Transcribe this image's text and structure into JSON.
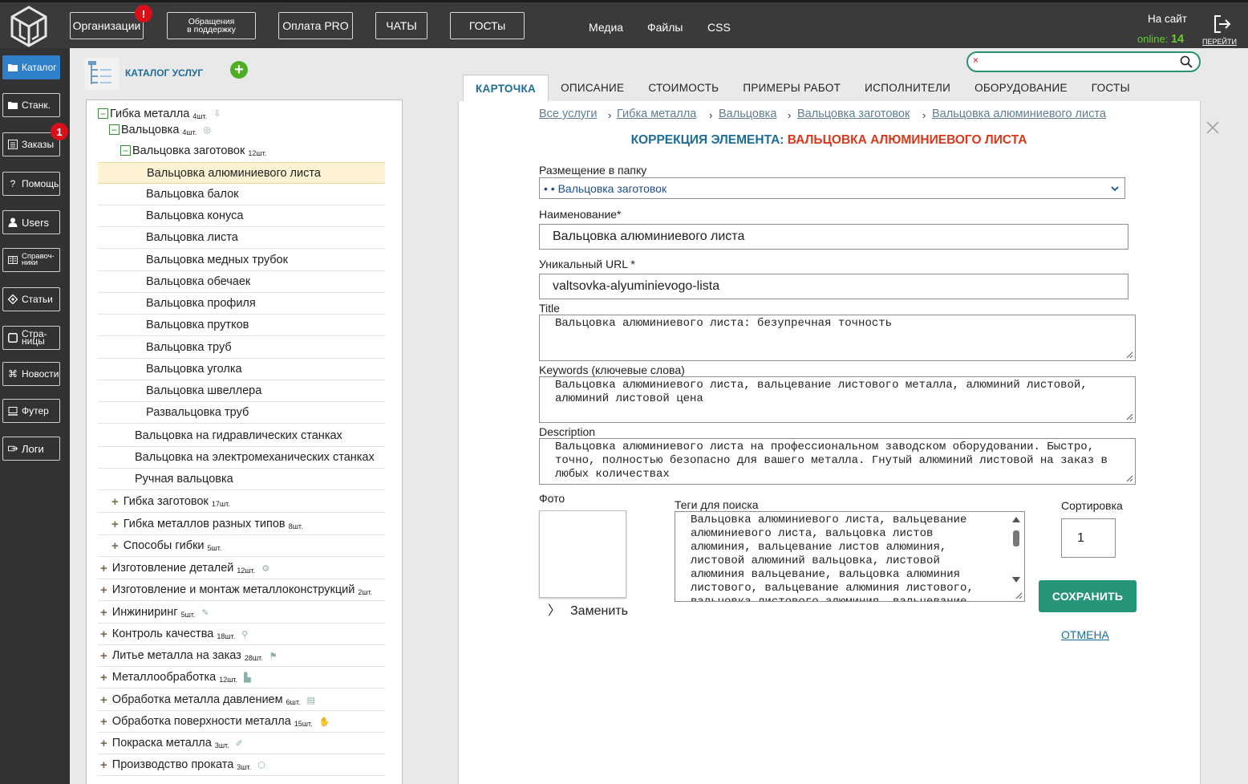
{
  "topbar": {
    "buttons": [
      {
        "label": "Организации"
      },
      {
        "label_line1": "Обращения",
        "label_line2": "в поддержку"
      },
      {
        "label": "Оплата PRO"
      },
      {
        "label": "ЧАТЫ"
      },
      {
        "label": "ГОСТы"
      }
    ],
    "org_badge": "!",
    "links": [
      "Медиа",
      "Файлы",
      "CSS"
    ],
    "onsite_label": "На сайт",
    "online_label": "online:",
    "online_count": "14",
    "exit_label": "ПЕРЕЙТИ"
  },
  "sidebar": {
    "items": [
      {
        "label": "Каталог",
        "icon": "folder-icon"
      },
      {
        "label": "Станк.",
        "icon": "folder-icon"
      },
      {
        "label": "Заказы",
        "icon": "list-icon",
        "badge": "1"
      },
      {
        "label": "Помощь",
        "icon": "question-icon"
      },
      {
        "label": "Users",
        "icon": "user-icon"
      },
      {
        "label_line1": "Справоч-",
        "label_line2": "ники",
        "icon": "book-icon"
      },
      {
        "label": "Статьи",
        "icon": "diamond-icon"
      },
      {
        "label_line1": "Стра-",
        "label_line2": "ницы",
        "icon": "page-icon"
      },
      {
        "label": "Новости",
        "icon": "command-icon"
      },
      {
        "label": "Футер",
        "icon": "monitor-icon"
      },
      {
        "label": "Логи",
        "icon": "log-icon"
      }
    ]
  },
  "catalog": {
    "title": "КАТАЛОГ УСЛУГ",
    "add_symbol": "+"
  },
  "tree": [
    {
      "label": "Гибка металла",
      "count": "4шт."
    },
    {
      "label": "Вальцовка",
      "count": "4шт."
    },
    {
      "label": "Вальцовка заготовок",
      "count": "12шт."
    },
    {
      "label": "Вальцовка алюминиевого листа"
    },
    {
      "label": "Вальцовка балок"
    },
    {
      "label": "Вальцовка конуса"
    },
    {
      "label": "Вальцовка листа"
    },
    {
      "label": "Вальцовка медных трубок"
    },
    {
      "label": "Вальцовка обечаек"
    },
    {
      "label": "Вальцовка профиля"
    },
    {
      "label": "Вальцовка прутков"
    },
    {
      "label": "Вальцовка труб"
    },
    {
      "label": "Вальцовка уголка"
    },
    {
      "label": "Вальцовка швеллера"
    },
    {
      "label": "Развальцовка труб"
    },
    {
      "label": "Вальцовка на гидравлических станках"
    },
    {
      "label": "Вальцовка на электромеханических станках"
    },
    {
      "label": "Ручная вальцовка"
    },
    {
      "label": "Гибка заготовок",
      "count": "17шт."
    },
    {
      "label": "Гибка металлов разных типов",
      "count": "8шт."
    },
    {
      "label": "Способы гибки",
      "count": "5шт."
    },
    {
      "label": "Изготовление деталей",
      "count": "12шт."
    },
    {
      "label": "Изготовление и монтаж металлоконструкций",
      "count": "2шт."
    },
    {
      "label": "Инжиниринг",
      "count": "5шт."
    },
    {
      "label": "Контроль качества",
      "count": "18шт."
    },
    {
      "label": "Литье металла на заказ",
      "count": "28шт."
    },
    {
      "label": "Металлообработка",
      "count": "12шт."
    },
    {
      "label": "Обработка металла давлением",
      "count": "6шт."
    },
    {
      "label": "Обработка поверхности металла",
      "count": "15шт."
    },
    {
      "label": "Покраска металла",
      "count": "3шт."
    },
    {
      "label": "Производство проката",
      "count": "3шт."
    }
  ],
  "search": {
    "placeholder": "",
    "clear": "×"
  },
  "tabs": [
    "КАРТОЧКА",
    "ОПИСАНИЕ",
    "СТОИМОСТЬ",
    "ПРИМЕРЫ РАБОТ",
    "ИСПОЛНИТЕЛИ",
    "ОБОРУДОВАНИЕ",
    "ГОСТЫ"
  ],
  "breadcrumbs": [
    "Все услуги",
    "Гибка металла",
    "Вальцовка",
    "Вальцовка заготовок",
    "Вальцовка алюминиевого листа"
  ],
  "breadcrumb_sep": "›",
  "form": {
    "title_prefix": "КОРРЕКЦИЯ ЭЛЕМЕНТА:",
    "title_name": "ВАЛЬЦОВКА АЛЮМИНИЕВОГО ЛИСТА",
    "folder_label": "Размещение в папку",
    "folder_value": "• • Вальцовка заготовок",
    "name_label": "Наименование*",
    "name_value": "Вальцовка алюминиевого листа",
    "url_label": "Уникальный URL *",
    "url_value": "valtsovka-alyuminievogo-lista",
    "title_field_label": "Title",
    "title_field_value": "Вальцовка алюминиевого листа: безупречная точность",
    "keywords_label": "Keywords (ключевые слова)",
    "keywords_value": "Вальцовка алюминиевого листа, вальцевание листового металла, алюминий листовой, алюминий листовой цена",
    "description_label": "Description",
    "description_value": "Вальцовка алюминиевого листа на профессиональном заводском оборудовании. Быстро, точно, полностью безопасно для вашего металла. Гнутый алюминий листовой на заказ в любых количествах",
    "photo_label": "Фото",
    "replace_label": "Заменить",
    "replace_chevron": "〉",
    "tags_label": "Теги для поиска",
    "tags_value": "Вальцовка алюминиевого листа, вальцевание алюминиевого листа, вальцовка листов алюминия, вальцевание листов алюминия, листовой алюминий вальцовка, листовой алюминия вальцевание, вальцовка алюминия листового, вальцевание алюминия листового, вальцовка листового алюминия, вальцевание листового алюминия",
    "sort_label": "Сортировка",
    "sort_value": "1",
    "save_label": "СОХРАНИТЬ",
    "cancel_label": "ОТМЕНА"
  },
  "colors": {
    "accent": "#1d6d9a",
    "save_green": "#27957a",
    "badge_red": "#d9101a",
    "title_red": "#d9391a",
    "sidebar_active": "#2f7fc9"
  }
}
